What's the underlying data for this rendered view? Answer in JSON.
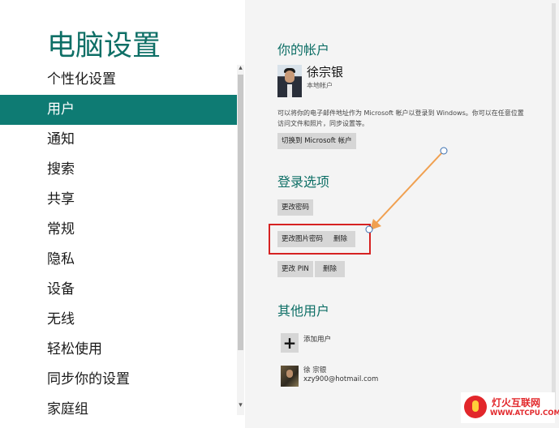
{
  "app": {
    "title": "电脑设置"
  },
  "nav": {
    "items": [
      {
        "label": "个性化设置"
      },
      {
        "label": "用户"
      },
      {
        "label": "通知"
      },
      {
        "label": "搜索"
      },
      {
        "label": "共享"
      },
      {
        "label": "常规"
      },
      {
        "label": "隐私"
      },
      {
        "label": "设备"
      },
      {
        "label": "无线"
      },
      {
        "label": "轻松使用"
      },
      {
        "label": "同步你的设置"
      },
      {
        "label": "家庭组"
      }
    ],
    "selected": "用户"
  },
  "account": {
    "heading": "你的帐户",
    "user_name": "徐宗银",
    "user_type": "本地帐户",
    "description": "可以将你的电子邮件地址作为 Microsoft 帐户以登录到 Windows。你可以在任意位置访问文件和照片，同步设置等。",
    "switch_button": "切换到 Microsoft 帐户"
  },
  "signin": {
    "heading": "登录选项",
    "change_password": "更改密码",
    "change_picture_password": "更改图片密码",
    "delete_picture_password": "删除",
    "change_pin": "更改 PIN",
    "delete_pin": "删除"
  },
  "other_users": {
    "heading": "其他用户",
    "add_user": "添加用户",
    "user_name": "徐 宗银",
    "user_email": "xzy900@hotmail.com"
  },
  "watermark": {
    "name": "灯火互联网",
    "url": "WWW.ATCPU.COM"
  },
  "colors": {
    "accent": "#0e7b73",
    "heading": "#0e6f66",
    "highlight": "#d62222",
    "arrow": "#f0a050"
  }
}
